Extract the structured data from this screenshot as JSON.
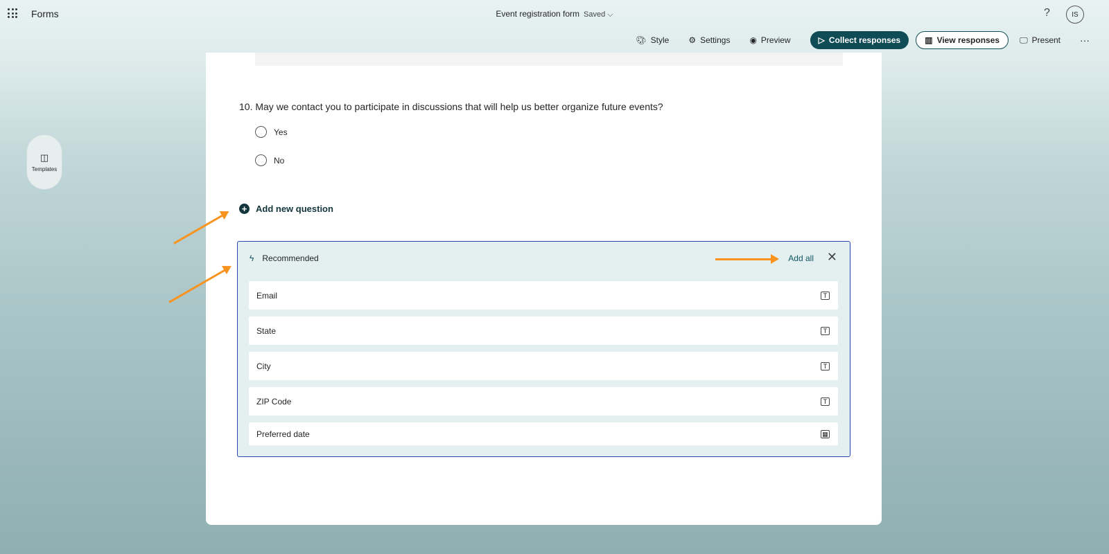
{
  "app": {
    "name": "Forms",
    "title": "Event registration form",
    "save_status": "Saved",
    "help": "?",
    "avatar": "IS"
  },
  "toolbar": {
    "style": "Style",
    "settings": "Settings",
    "preview": "Preview",
    "collect": "Collect responses",
    "view": "View responses",
    "present": "Present",
    "more": "···"
  },
  "sidebar": {
    "templates": "Templates"
  },
  "question": {
    "text": "10. May we contact you to participate in discussions that will help us better organize future events?",
    "options": [
      "Yes",
      "No"
    ]
  },
  "add_question": "Add new question",
  "recommended": {
    "title": "Recommended",
    "add_all": "Add all",
    "close": "✕",
    "items": [
      {
        "label": "Email",
        "icon": "text-icon"
      },
      {
        "label": "State",
        "icon": "text-icon"
      },
      {
        "label": "City",
        "icon": "text-icon"
      },
      {
        "label": "ZIP Code",
        "icon": "text-icon"
      },
      {
        "label": "Preferred date",
        "icon": "calendar-icon"
      }
    ]
  },
  "colors": {
    "accent": "#0f4c55",
    "annotation": "#f7931e",
    "border": "#2646b8"
  }
}
